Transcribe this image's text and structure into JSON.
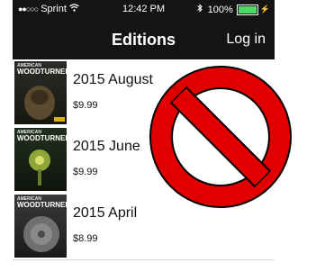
{
  "status": {
    "carrier": "Sprint",
    "time": "12:42 PM",
    "battery": "100%",
    "battery_level": 1.0
  },
  "nav": {
    "title": "Editions",
    "login_label": "Log in"
  },
  "editions": [
    {
      "title": "2015 August",
      "price": "$9.99",
      "cover_brand": "AMERICAN",
      "cover_brand2": "WOODTURNER"
    },
    {
      "title": "2015 June",
      "price": "$9.99",
      "cover_brand": "AMERICAN",
      "cover_brand2": "WOODTURNER"
    },
    {
      "title": "2015 April",
      "price": "$8.99",
      "cover_brand": "AMERICAN",
      "cover_brand2": "WOODTURNER"
    }
  ],
  "colors": {
    "bar_background": "#141414",
    "battery_fill": "#4cd964",
    "prohibition_red": "#e00000"
  },
  "icons": [
    "signal-dots-icon",
    "wifi-icon",
    "bluetooth-icon",
    "battery-icon",
    "charging-bolt-icon",
    "prohibition-icon"
  ]
}
